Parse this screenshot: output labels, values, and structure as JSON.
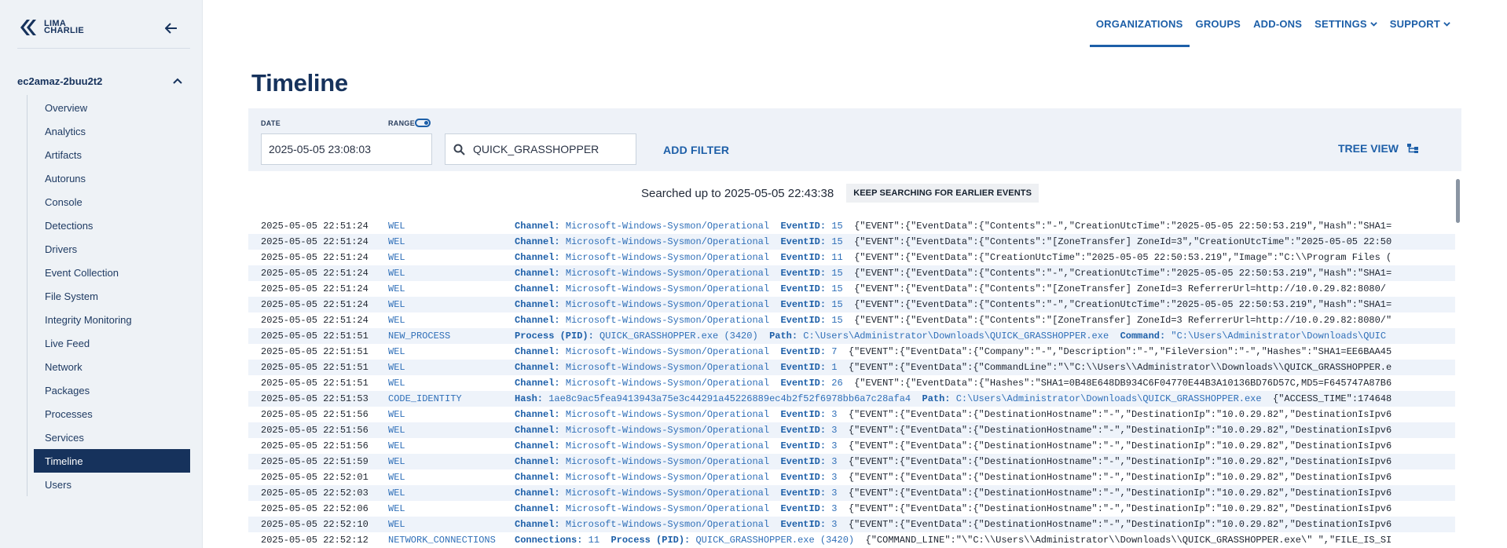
{
  "brand": {
    "line1": "LIMA",
    "line2": "CHARLIE"
  },
  "sidebar": {
    "org": "ec2amaz-2buu2t2",
    "items": [
      "Overview",
      "Analytics",
      "Artifacts",
      "Autoruns",
      "Console",
      "Detections",
      "Drivers",
      "Event Collection",
      "File System",
      "Integrity Monitoring",
      "Live Feed",
      "Network",
      "Packages",
      "Processes",
      "Services",
      "Timeline",
      "Users"
    ],
    "active": "Timeline"
  },
  "topnav": {
    "organizations": "ORGANIZATIONS",
    "groups": "GROUPS",
    "addons": "ADD-ONS",
    "settings": "SETTINGS",
    "support": "SUPPORT"
  },
  "page": {
    "title": "Timeline"
  },
  "filters": {
    "date_label": "DATE",
    "date_value": "2025-05-05 23:08:03",
    "range_label": "RANGE",
    "search_value": "QUICK_GRASSHOPPER",
    "add_filter": "ADD FILTER",
    "tree_view": "TREE VIEW"
  },
  "status": {
    "searched_text": "Searched up to 2025-05-05 22:43:38",
    "keep_searching": "KEEP SEARCHING FOR EARLIER EVENTS"
  },
  "colors": {
    "accent": "#1d5fa8",
    "navy": "#16325c",
    "sidebar_bg": "#eef2f6",
    "row_alt": "#eef3fa"
  },
  "events": [
    {
      "time": "2025-05-05 22:51:24",
      "type": "WEL",
      "fields": [
        [
          "Channel:",
          "Microsoft-Windows-Sysmon/Operational"
        ],
        [
          "EventID:",
          "15"
        ]
      ],
      "json": "{\"EVENT\":{\"EventData\":{\"Contents\":\"-\",\"CreationUtcTime\":\"2025-05-05 22:50:53.219\",\"Hash\":\"SHA1="
    },
    {
      "time": "2025-05-05 22:51:24",
      "type": "WEL",
      "fields": [
        [
          "Channel:",
          "Microsoft-Windows-Sysmon/Operational"
        ],
        [
          "EventID:",
          "15"
        ]
      ],
      "json": "{\"EVENT\":{\"EventData\":{\"Contents\":\"[ZoneTransfer] ZoneId=3\",\"CreationUtcTime\":\"2025-05-05 22:50"
    },
    {
      "time": "2025-05-05 22:51:24",
      "type": "WEL",
      "fields": [
        [
          "Channel:",
          "Microsoft-Windows-Sysmon/Operational"
        ],
        [
          "EventID:",
          "11"
        ]
      ],
      "json": "{\"EVENT\":{\"EventData\":{\"CreationUtcTime\":\"2025-05-05 22:50:53.219\",\"Image\":\"C:\\\\Program Files ("
    },
    {
      "time": "2025-05-05 22:51:24",
      "type": "WEL",
      "fields": [
        [
          "Channel:",
          "Microsoft-Windows-Sysmon/Operational"
        ],
        [
          "EventID:",
          "15"
        ]
      ],
      "json": "{\"EVENT\":{\"EventData\":{\"Contents\":\"-\",\"CreationUtcTime\":\"2025-05-05 22:50:53.219\",\"Hash\":\"SHA1="
    },
    {
      "time": "2025-05-05 22:51:24",
      "type": "WEL",
      "fields": [
        [
          "Channel:",
          "Microsoft-Windows-Sysmon/Operational"
        ],
        [
          "EventID:",
          "15"
        ]
      ],
      "json": "{\"EVENT\":{\"EventData\":{\"Contents\":\"[ZoneTransfer] ZoneId=3 ReferrerUrl=http://10.0.29.82:8080/"
    },
    {
      "time": "2025-05-05 22:51:24",
      "type": "WEL",
      "fields": [
        [
          "Channel:",
          "Microsoft-Windows-Sysmon/Operational"
        ],
        [
          "EventID:",
          "15"
        ]
      ],
      "json": "{\"EVENT\":{\"EventData\":{\"Contents\":\"-\",\"CreationUtcTime\":\"2025-05-05 22:50:53.219\",\"Hash\":\"SHA1="
    },
    {
      "time": "2025-05-05 22:51:24",
      "type": "WEL",
      "fields": [
        [
          "Channel:",
          "Microsoft-Windows-Sysmon/Operational"
        ],
        [
          "EventID:",
          "15"
        ]
      ],
      "json": "{\"EVENT\":{\"EventData\":{\"Contents\":\"[ZoneTransfer] ZoneId=3 ReferrerUrl=http://10.0.29.82:8080/\""
    },
    {
      "time": "2025-05-05 22:51:51",
      "type": "NEW_PROCESS",
      "fields": [
        [
          "Process (PID):",
          "QUICK_GRASSHOPPER.exe (3420)"
        ],
        [
          "Path:",
          "C:\\Users\\Administrator\\Downloads\\QUICK_GRASSHOPPER.exe"
        ],
        [
          "Command:",
          "\"C:\\Users\\Administrator\\Downloads\\QUIC"
        ]
      ],
      "json": ""
    },
    {
      "time": "2025-05-05 22:51:51",
      "type": "WEL",
      "fields": [
        [
          "Channel:",
          "Microsoft-Windows-Sysmon/Operational"
        ],
        [
          "EventID:",
          "7"
        ]
      ],
      "json": "{\"EVENT\":{\"EventData\":{\"Company\":\"-\",\"Description\":\"-\",\"FileVersion\":\"-\",\"Hashes\":\"SHA1=EE6BAA45"
    },
    {
      "time": "2025-05-05 22:51:51",
      "type": "WEL",
      "fields": [
        [
          "Channel:",
          "Microsoft-Windows-Sysmon/Operational"
        ],
        [
          "EventID:",
          "1"
        ]
      ],
      "json": "{\"EVENT\":{\"EventData\":{\"CommandLine\":\"\\\"C:\\\\Users\\\\Administrator\\\\Downloads\\\\QUICK_GRASSHOPPER.e"
    },
    {
      "time": "2025-05-05 22:51:51",
      "type": "WEL",
      "fields": [
        [
          "Channel:",
          "Microsoft-Windows-Sysmon/Operational"
        ],
        [
          "EventID:",
          "26"
        ]
      ],
      "json": "{\"EVENT\":{\"EventData\":{\"Hashes\":\"SHA1=0B48E648DB934C6F04770E44B3A10136BD76D57C,MD5=F645747A87B6"
    },
    {
      "time": "2025-05-05 22:51:53",
      "type": "CODE_IDENTITY",
      "fields": [
        [
          "Hash:",
          "1ae8c9ac5fea9413943a75e3c44291a45226889ec4b2f52f6978bb6a7c28afa4"
        ],
        [
          "Path:",
          "C:\\Users\\Administrator\\Downloads\\QUICK_GRASSHOPPER.exe"
        ]
      ],
      "json": "{\"ACCESS_TIME\":174648"
    },
    {
      "time": "2025-05-05 22:51:56",
      "type": "WEL",
      "fields": [
        [
          "Channel:",
          "Microsoft-Windows-Sysmon/Operational"
        ],
        [
          "EventID:",
          "3"
        ]
      ],
      "json": "{\"EVENT\":{\"EventData\":{\"DestinationHostname\":\"-\",\"DestinationIp\":\"10.0.29.82\",\"DestinationIsIpv6"
    },
    {
      "time": "2025-05-05 22:51:56",
      "type": "WEL",
      "fields": [
        [
          "Channel:",
          "Microsoft-Windows-Sysmon/Operational"
        ],
        [
          "EventID:",
          "3"
        ]
      ],
      "json": "{\"EVENT\":{\"EventData\":{\"DestinationHostname\":\"-\",\"DestinationIp\":\"10.0.29.82\",\"DestinationIsIpv6"
    },
    {
      "time": "2025-05-05 22:51:56",
      "type": "WEL",
      "fields": [
        [
          "Channel:",
          "Microsoft-Windows-Sysmon/Operational"
        ],
        [
          "EventID:",
          "3"
        ]
      ],
      "json": "{\"EVENT\":{\"EventData\":{\"DestinationHostname\":\"-\",\"DestinationIp\":\"10.0.29.82\",\"DestinationIsIpv6"
    },
    {
      "time": "2025-05-05 22:51:59",
      "type": "WEL",
      "fields": [
        [
          "Channel:",
          "Microsoft-Windows-Sysmon/Operational"
        ],
        [
          "EventID:",
          "3"
        ]
      ],
      "json": "{\"EVENT\":{\"EventData\":{\"DestinationHostname\":\"-\",\"DestinationIp\":\"10.0.29.82\",\"DestinationIsIpv6"
    },
    {
      "time": "2025-05-05 22:52:01",
      "type": "WEL",
      "fields": [
        [
          "Channel:",
          "Microsoft-Windows-Sysmon/Operational"
        ],
        [
          "EventID:",
          "3"
        ]
      ],
      "json": "{\"EVENT\":{\"EventData\":{\"DestinationHostname\":\"-\",\"DestinationIp\":\"10.0.29.82\",\"DestinationIsIpv6"
    },
    {
      "time": "2025-05-05 22:52:03",
      "type": "WEL",
      "fields": [
        [
          "Channel:",
          "Microsoft-Windows-Sysmon/Operational"
        ],
        [
          "EventID:",
          "3"
        ]
      ],
      "json": "{\"EVENT\":{\"EventData\":{\"DestinationHostname\":\"-\",\"DestinationIp\":\"10.0.29.82\",\"DestinationIsIpv6"
    },
    {
      "time": "2025-05-05 22:52:06",
      "type": "WEL",
      "fields": [
        [
          "Channel:",
          "Microsoft-Windows-Sysmon/Operational"
        ],
        [
          "EventID:",
          "3"
        ]
      ],
      "json": "{\"EVENT\":{\"EventData\":{\"DestinationHostname\":\"-\",\"DestinationIp\":\"10.0.29.82\",\"DestinationIsIpv6"
    },
    {
      "time": "2025-05-05 22:52:10",
      "type": "WEL",
      "fields": [
        [
          "Channel:",
          "Microsoft-Windows-Sysmon/Operational"
        ],
        [
          "EventID:",
          "3"
        ]
      ],
      "json": "{\"EVENT\":{\"EventData\":{\"DestinationHostname\":\"-\",\"DestinationIp\":\"10.0.29.82\",\"DestinationIsIpv6"
    },
    {
      "time": "2025-05-05 22:52:12",
      "type": "NETWORK_CONNECTIONS",
      "fields": [
        [
          "Connections:",
          "11"
        ],
        [
          "Process (PID):",
          "QUICK_GRASSHOPPER.exe (3420)"
        ]
      ],
      "json": "{\"COMMAND_LINE\":\"\\\"C:\\\\Users\\\\Administrator\\\\Downloads\\\\QUICK_GRASSHOPPER.exe\\\" \",\"FILE_IS_SI"
    }
  ]
}
